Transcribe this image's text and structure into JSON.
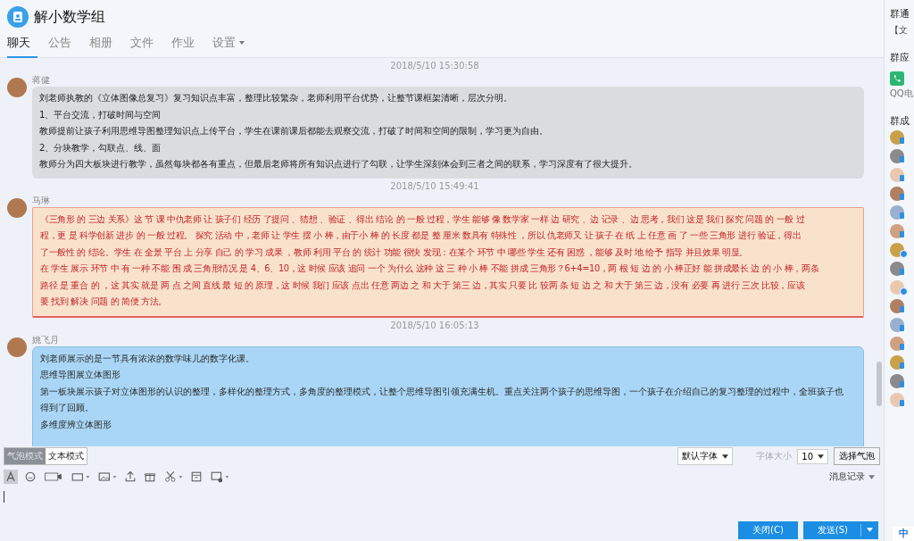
{
  "window": {
    "title": "解小数学组"
  },
  "tabs": [
    {
      "label": "聊天",
      "selected": true,
      "has_menu": false
    },
    {
      "label": "公告",
      "selected": false,
      "has_menu": false
    },
    {
      "label": "相册",
      "selected": false,
      "has_menu": false
    },
    {
      "label": "文件",
      "selected": false,
      "has_menu": false
    },
    {
      "label": "作业",
      "selected": false,
      "has_menu": false
    },
    {
      "label": "设置",
      "selected": false,
      "has_menu": true
    }
  ],
  "messages": [
    {
      "time": "2018/5/10 15:30:58",
      "sender": "蒋健",
      "kind": "gray",
      "lines": [
        "刘老师执教的《立体图像总复习》复习知识点丰富，整理比较繁杂，老师利用平台优势，让整节课框架清晰，层次分明。",
        "1、平台交流，打破时间与空间",
        "教师提前让孩子利用思维导图整理知识点上传平台，学生在课前课后都能去观察交流，打破了时间和空间的限制，学习更为自由。",
        "2、分块教学，勾联点、线、面",
        "教师分为四大板块进行教学，虽然每块都各有重点，但最后老师将所有知识点进行了勾联，让学生深刻体会到三者之间的联系，学习深度有了很大提升。"
      ]
    },
    {
      "time": "2018/5/10 15:49:41",
      "sender": "马琳",
      "kind": "red",
      "lines": [
        "《三角形 的 三边 关系》这 节 课 中仇老师 让 孩子们 经历 了提问 、猜想 、验证 、得出 结论 的 一般 过程，学生 能够 像 数学家 一样 边 研究 、边 记录 、边 思考，我们 这是 我们 探究 问题 的 一般 过",
        "程，更 是 科学创新 进步 的 一般 过程。     探究 活动 中，老师 让 学生 摆 小 棒，由于小 棒 的 长度 都是 整 厘米 数具有 特殊性 ，所以 仇老师又 让 孩子 在 纸 上 任意 画 了 一些 三角形 进行 验证，得出",
        "了一般性 的 结论。学生 在 全景 平台 上 分享 自己 的 学习 成果 ，教师 利用 平台 的 统计 功能 很快 发现：在某个 环节 中 哪些 学生 还有 困惑 ，能够 及时 地 给予 指导 并且效果 明显。",
        "在 学生 展示 环节 中 有 一种 不能 围 成 三角形情况 是 4、6、10，这 时候 应该 追问 一个 为什么 这种 这 三 种 小 棒 不能 拼成 三角形？6+4=10，两 根 短 边 的 小 棒正好 能 拼成最长 边 的 小 棒，两条",
        "路径 是 重合 的 ，这 其实 就是 两 点 之间 直线 最 短 的 原理，这 时候 我们 应该 点出 任意 两边 之 和 大于 第三 边，其实 只要 比 较两 条 短 边 之 和 大于 第三 边，没有 必要 再 进行 三次 比较，应该",
        "要 找到 解决 问题 的 简便 方法。"
      ]
    },
    {
      "time": "2018/5/10 16:05:13",
      "sender": "姚飞月",
      "kind": "blue",
      "lines": [
        "刘老师展示的是一节具有浓浓的数学味儿的数字化课。",
        "思维导图展立体图形",
        "第一板块展示孩子对立体图形的认识的整理，多样化的整理方式，多角度的整理模式，让整个思维导图引领充满生机。重点关注两个孩子的思维导图，一个孩子在介绍自己的复习整理的过程中，全班孩子也",
        "得到了回顾。",
        "多维度辨立体图形"
      ]
    }
  ],
  "modes": [
    {
      "label": "气泡模式",
      "selected": true
    },
    {
      "label": "文本模式",
      "selected": false
    }
  ],
  "font_select": "默认字体",
  "font_size_label": "字体大小",
  "font_size": "10",
  "bubble_button": "选择气泡",
  "history": "消息记录",
  "buttons": {
    "close": "关闭(C)",
    "send": "发送(S)"
  },
  "ime": "中",
  "sidebar": {
    "notice_title": "群通",
    "notice_item": "【文",
    "apps_title": "群应",
    "app": "QQ电",
    "members_title": "群成",
    "members": [
      {
        "starred": false
      },
      {
        "starred": false
      },
      {
        "starred": false
      },
      {
        "starred": false
      },
      {
        "starred": false
      },
      {
        "starred": false
      },
      {
        "starred": true
      },
      {
        "starred": false
      },
      {
        "starred": true
      },
      {
        "starred": false
      },
      {
        "starred": false
      },
      {
        "starred": false
      },
      {
        "starred": false
      },
      {
        "starred": false
      },
      {
        "starred": false
      }
    ]
  }
}
